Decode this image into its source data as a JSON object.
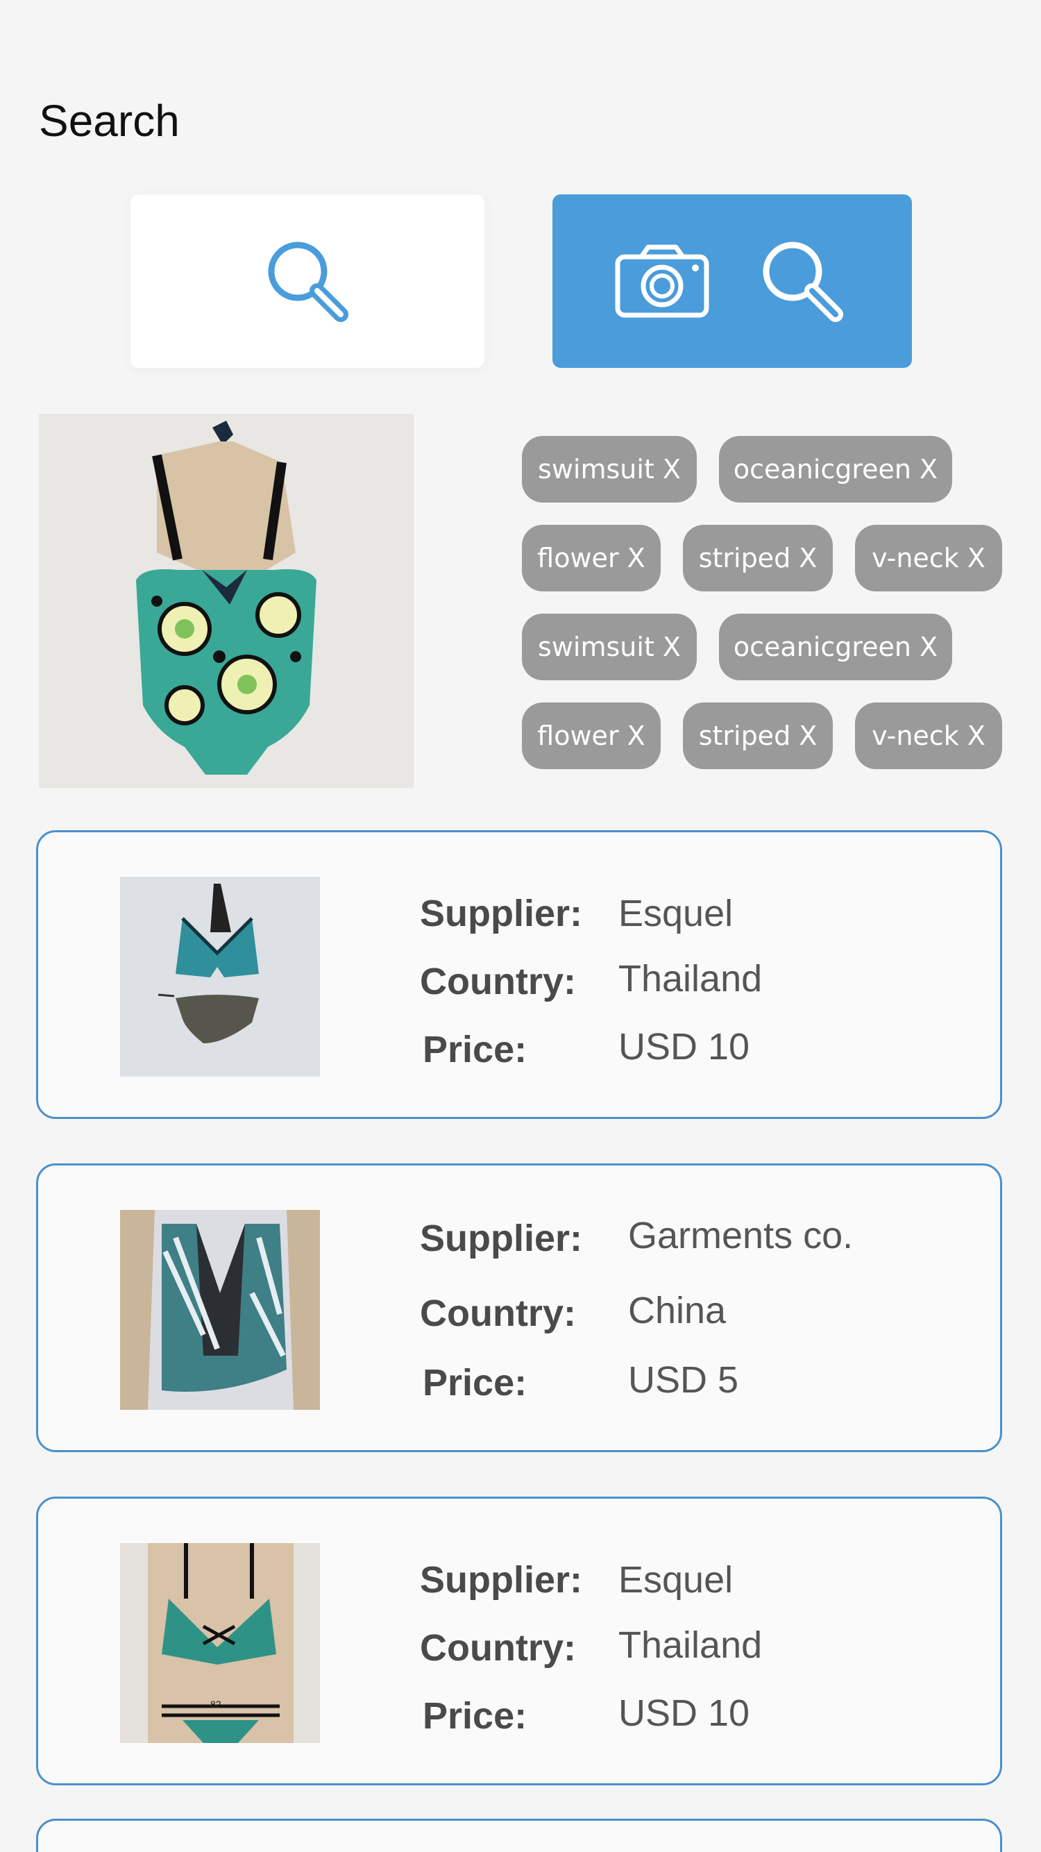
{
  "header": {
    "title": "Search"
  },
  "search": {
    "text_button_icon": "search-icon",
    "image_button_icons": [
      "camera-icon",
      "search-icon"
    ],
    "accent_color": "#4a9cdb"
  },
  "tags": [
    {
      "label": "swimsuit X"
    },
    {
      "label": "oceanicgreen X"
    },
    {
      "label": "flower X"
    },
    {
      "label": "striped X"
    },
    {
      "label": "v-neck X"
    },
    {
      "label": "swimsuit X"
    },
    {
      "label": "oceanicgreen X"
    },
    {
      "label": "flower X"
    },
    {
      "label": "striped X"
    },
    {
      "label": "v-neck X"
    }
  ],
  "labels": {
    "supplier": "Supplier:",
    "country": "Country:",
    "price": "Price:"
  },
  "results": [
    {
      "supplier": "Esquel",
      "country": "Thailand",
      "price": "USD 10"
    },
    {
      "supplier": "Garments co.",
      "country": "China",
      "price": "USD 5"
    },
    {
      "supplier": "Esquel",
      "country": "Thailand",
      "price": "USD 10"
    }
  ]
}
